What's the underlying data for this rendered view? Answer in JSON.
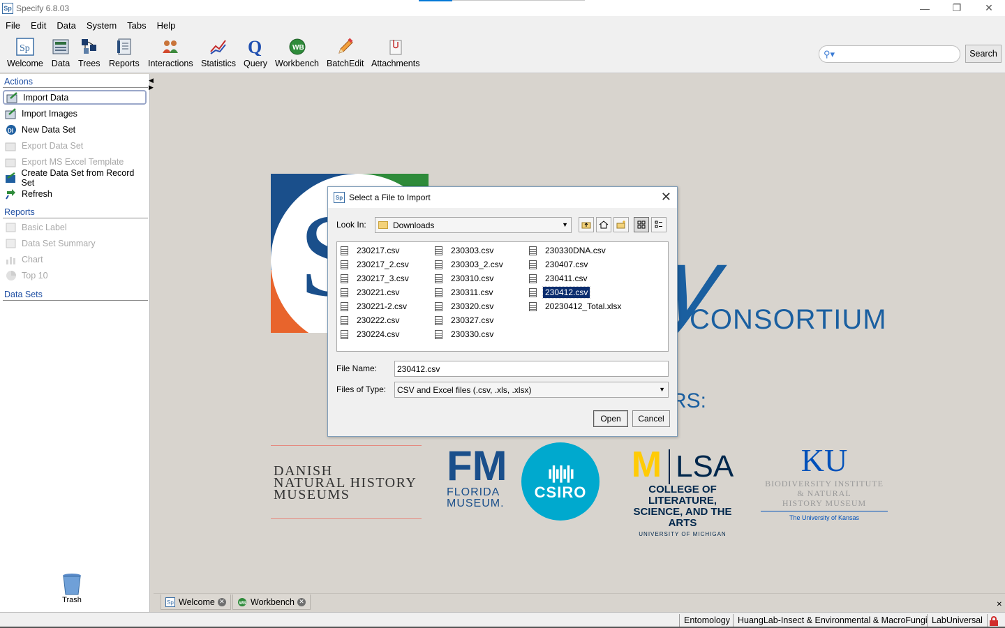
{
  "window": {
    "title": "Specify 6.8.03",
    "app_icon": "Sp",
    "controls": [
      "—",
      "❐",
      "✕"
    ]
  },
  "menu": [
    "File",
    "Edit",
    "Data",
    "System",
    "Tabs",
    "Help"
  ],
  "toolbar": {
    "items": [
      {
        "label": "Welcome",
        "icon": "specify-logo-icon"
      },
      {
        "label": "Data",
        "icon": "data-form-icon"
      },
      {
        "label": "Trees",
        "icon": "tree-icon"
      },
      {
        "label": "Reports",
        "icon": "reports-icon"
      },
      {
        "label": "Interactions",
        "icon": "people-icon"
      },
      {
        "label": "Statistics",
        "icon": "line-chart-icon"
      },
      {
        "label": "Query",
        "icon": "query-q-icon"
      },
      {
        "label": "Workbench",
        "icon": "workbench-icon"
      },
      {
        "label": "BatchEdit",
        "icon": "pencil-icon"
      },
      {
        "label": "Attachments",
        "icon": "attachment-icon"
      }
    ],
    "search_button": "Search",
    "search_value": ""
  },
  "sidebar": {
    "actions_title": "Actions",
    "actions": [
      {
        "label": "Import Data",
        "enabled": true,
        "selected": true
      },
      {
        "label": "Import Images",
        "enabled": true
      },
      {
        "label": "New Data Set",
        "enabled": true
      },
      {
        "label": "Export Data Set",
        "enabled": false
      },
      {
        "label": "Export MS Excel Template",
        "enabled": false
      },
      {
        "label": "Create Data Set from Record Set",
        "enabled": true
      },
      {
        "label": "Refresh",
        "enabled": true
      }
    ],
    "reports_title": "Reports",
    "reports": [
      {
        "label": "Basic Label",
        "enabled": false
      },
      {
        "label": "Data Set Summary",
        "enabled": false
      },
      {
        "label": "Chart",
        "enabled": false
      },
      {
        "label": "Top 10",
        "enabled": false
      }
    ],
    "datasets_title": "Data Sets",
    "trash_label": "Trash"
  },
  "welcome": {
    "consortium": "CONSORTIUM",
    "partners_tail": "RS:",
    "danish": [
      "DANISH",
      "NATURAL HISTORY",
      "MUSEUMS"
    ],
    "florida": [
      "FLORIDA",
      "MUSEUM."
    ],
    "csiro": "CSIRO",
    "umich": {
      "lsa": "LSA",
      "line1": "COLLEGE OF LITERATURE,",
      "line2": "SCIENCE, AND THE ARTS",
      "line3": "UNIVERSITY OF MICHIGAN"
    },
    "ku": {
      "mark": "KU",
      "line1": "BIODIVERSITY INSTITUTE",
      "line2": "& NATURAL",
      "line3": "HISTORY MUSEUM",
      "line4": "The University of Kansas"
    }
  },
  "dialog": {
    "title": "Select a File to Import",
    "look_in_label": "Look In:",
    "look_in_value": "Downloads",
    "files": [
      [
        "230217.csv",
        "230217_2.csv",
        "230217_3.csv",
        "230221.csv",
        "230221-2.csv",
        "230222.csv",
        "230224.csv"
      ],
      [
        "230303.csv",
        "230303_2.csv",
        "230310.csv",
        "230311.csv",
        "230320.csv",
        "230327.csv",
        "230330.csv"
      ],
      [
        "230330DNA.csv",
        "230407.csv",
        "230411.csv",
        "230412.csv",
        "20230412_Total.xlsx"
      ]
    ],
    "selected_file": "230412.csv",
    "file_name_label": "File Name:",
    "file_name_value": "230412.csv",
    "file_type_label": "Files of Type:",
    "file_type_value": "CSV and Excel files (.csv, .xls, .xlsx)",
    "open_label": "Open",
    "cancel_label": "Cancel"
  },
  "tabs": [
    {
      "label": "Welcome",
      "icon": "specify-logo-icon"
    },
    {
      "label": "Workbench",
      "icon": "workbench-icon"
    }
  ],
  "status": {
    "discipline": "Entomology",
    "collection": "HuangLab-Insect & Environmental & MacroFungi",
    "user": "LabUniversal"
  }
}
